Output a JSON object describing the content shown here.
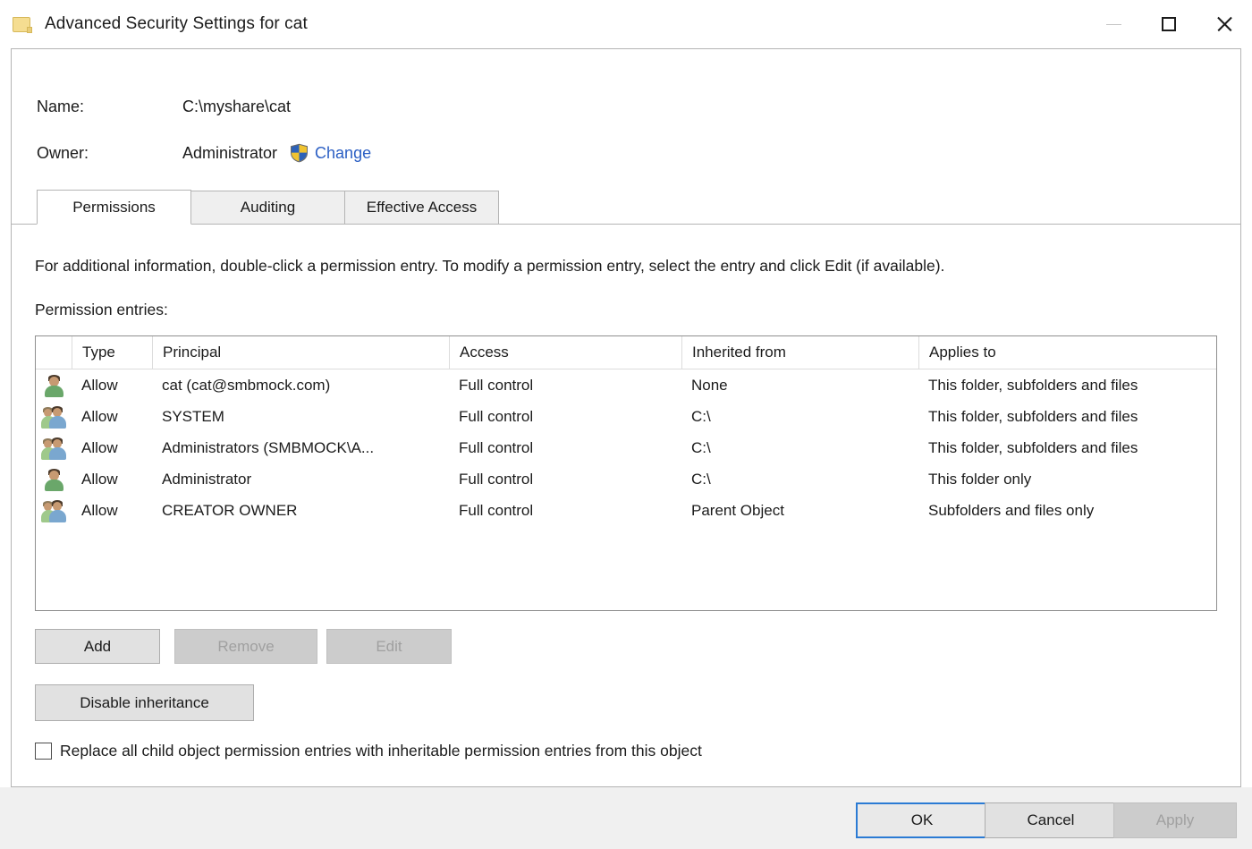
{
  "window": {
    "title": "Advanced Security Settings for cat",
    "folder_icon": "folder-icon",
    "controls": {
      "minimize": "minimize-icon",
      "maximize": "maximize-icon",
      "close": "close-icon"
    }
  },
  "header": {
    "name_label": "Name:",
    "name_value": "C:\\myshare\\cat",
    "owner_label": "Owner:",
    "owner_value": "Administrator",
    "change_link": "Change",
    "shield_icon": "uac-shield-icon"
  },
  "tabs": [
    {
      "label": "Permissions",
      "selected": true
    },
    {
      "label": "Auditing",
      "selected": false
    },
    {
      "label": "Effective Access",
      "selected": false
    }
  ],
  "main": {
    "info_text": "For additional information, double-click a permission entry. To modify a permission entry, select the entry and click Edit (if available).",
    "entries_label": "Permission entries:"
  },
  "table": {
    "columns": [
      "",
      "Type",
      "Principal",
      "Access",
      "Inherited from",
      "Applies to"
    ],
    "rows": [
      {
        "icon": "user-icon",
        "type": "Allow",
        "principal": "cat (cat@smbmock.com)",
        "access": "Full control",
        "inherited_from": "None",
        "applies_to": "This folder, subfolders and files"
      },
      {
        "icon": "group-icon",
        "type": "Allow",
        "principal": "SYSTEM",
        "access": "Full control",
        "inherited_from": "C:\\",
        "applies_to": "This folder, subfolders and files"
      },
      {
        "icon": "group-icon",
        "type": "Allow",
        "principal": "Administrators (SMBMOCK\\A...",
        "access": "Full control",
        "inherited_from": "C:\\",
        "applies_to": "This folder, subfolders and files"
      },
      {
        "icon": "user-icon",
        "type": "Allow",
        "principal": "Administrator",
        "access": "Full control",
        "inherited_from": "C:\\",
        "applies_to": "This folder only"
      },
      {
        "icon": "group-icon",
        "type": "Allow",
        "principal": "CREATOR OWNER",
        "access": "Full control",
        "inherited_from": "Parent Object",
        "applies_to": "Subfolders and files only"
      }
    ]
  },
  "actions": {
    "add": "Add",
    "remove": "Remove",
    "edit": "Edit",
    "disable_inheritance": "Disable inheritance",
    "add_enabled": true,
    "remove_enabled": false,
    "edit_enabled": false
  },
  "replace_option": {
    "label": "Replace all child object permission entries with inheritable permission entries from this object",
    "checked": false
  },
  "footer": {
    "ok": "OK",
    "cancel": "Cancel",
    "apply": "Apply",
    "apply_enabled": false
  },
  "colors": {
    "link": "#2b5fc4",
    "focus_border": "#2b7bd4",
    "disabled_text": "#a0a0a0",
    "window_bg": "#ffffff",
    "footer_bg": "#f0f0f0"
  }
}
